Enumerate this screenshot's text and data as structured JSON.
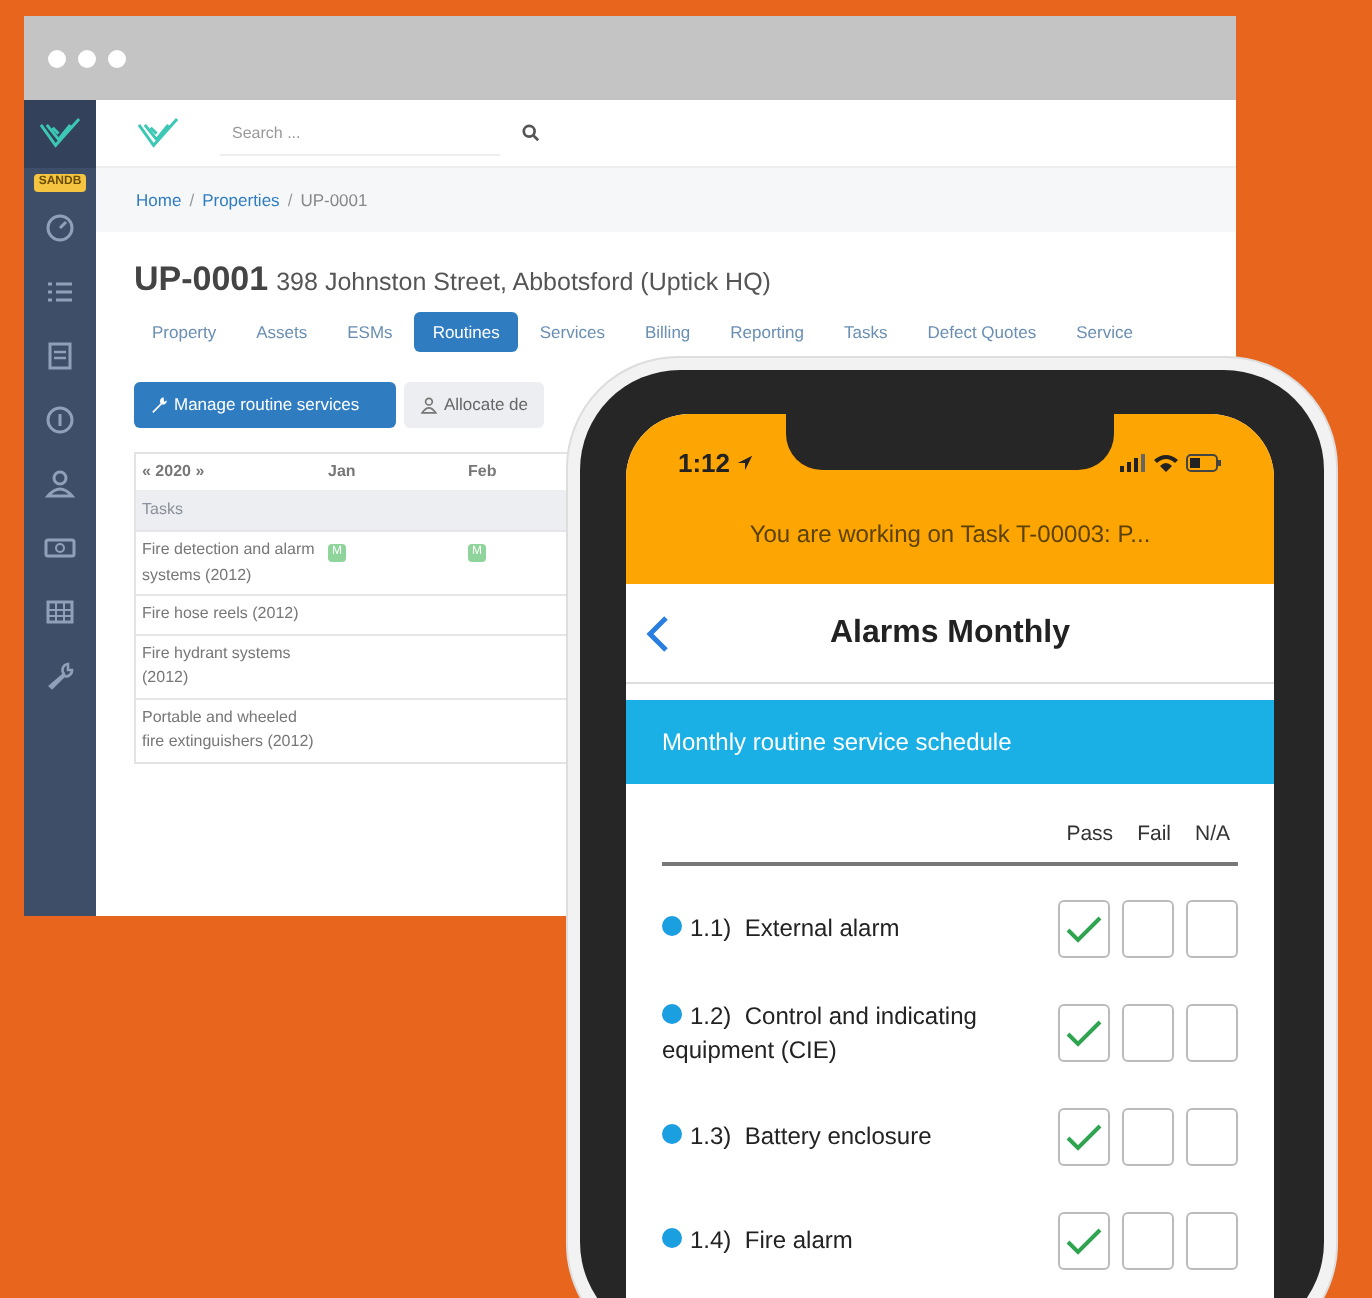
{
  "browser": {
    "sidebar": {
      "badge": "SANDB"
    },
    "search": {
      "placeholder": "Search ..."
    },
    "breadcrumb": [
      {
        "label": "Home",
        "kind": "link"
      },
      {
        "label": "/",
        "kind": "separator"
      },
      {
        "label": "Properties",
        "kind": "link"
      },
      {
        "label": "/",
        "kind": "separator"
      },
      {
        "label": "UP-0001",
        "kind": "current"
      }
    ],
    "property": {
      "code": "UP-0001",
      "address": "398 Johnston Street, Abbotsford (Uptick HQ)"
    },
    "tabs": [
      {
        "label": "Property",
        "selected": false
      },
      {
        "label": "Assets",
        "selected": false
      },
      {
        "label": "ESMs",
        "selected": false
      },
      {
        "label": "Routines",
        "selected": true
      },
      {
        "label": "Services",
        "selected": false
      },
      {
        "label": "Billing",
        "selected": false
      },
      {
        "label": "Reporting",
        "selected": false
      },
      {
        "label": "Tasks",
        "selected": false
      },
      {
        "label": "Defect Quotes",
        "selected": false
      },
      {
        "label": "Service",
        "selected": false
      }
    ],
    "buttons": [
      {
        "label": "Manage routine services",
        "kind": "primary"
      },
      {
        "label": "Allocate de",
        "kind": "secondary"
      }
    ],
    "schedule": {
      "year": "« 2020 »",
      "months": [
        "Jan",
        "Feb"
      ],
      "section": "Tasks",
      "rows": [
        {
          "name": "Fire detection and alarm systems (2012)",
          "marks": [
            "M",
            "M"
          ]
        },
        {
          "name": "Fire hose reels (2012)",
          "marks": []
        },
        {
          "name": "Fire hydrant systems (2012)",
          "marks": []
        },
        {
          "name": "Portable and wheeled fire extinguishers (2012)",
          "marks": []
        }
      ]
    }
  },
  "phone": {
    "time": "1:12",
    "banner": "You are working on Task T-00003: P...",
    "title": "Alarms Monthly",
    "section": "Monthly routine service schedule",
    "columns": [
      "Pass",
      "Fail",
      "N/A"
    ],
    "items": [
      {
        "number": "1.1)",
        "label": "External alarm",
        "pass": true,
        "fail": false,
        "na": false
      },
      {
        "number": "1.2)",
        "label": "Control and indicating equipment (CIE)",
        "pass": true,
        "fail": false,
        "na": false
      },
      {
        "number": "1.3)",
        "label": "Battery enclosure",
        "pass": true,
        "fail": false,
        "na": false
      },
      {
        "number": "1.4)",
        "label": "Fire alarm",
        "pass": true,
        "fail": false,
        "na": false
      }
    ]
  }
}
